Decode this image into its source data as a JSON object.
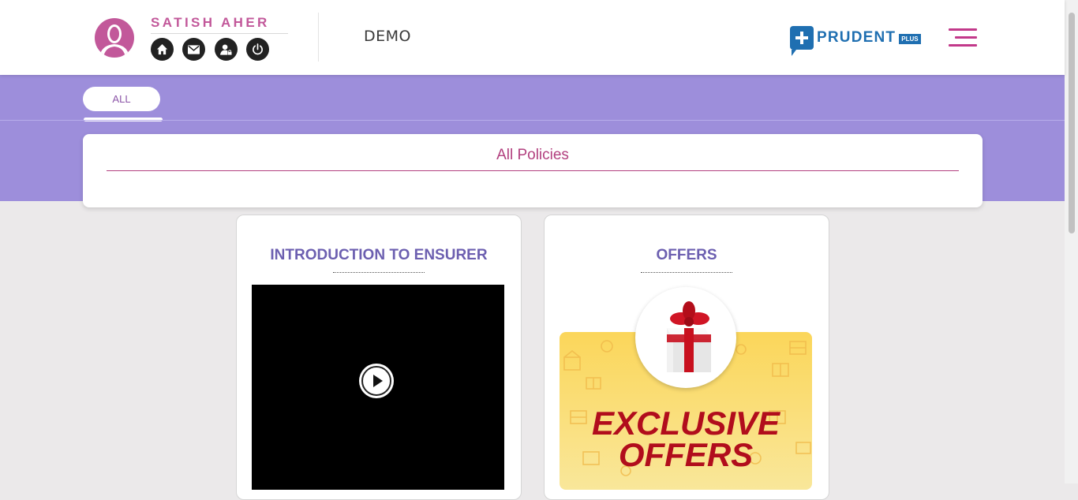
{
  "header": {
    "user_name": "SATISH AHER",
    "brand_logo": "DEMO",
    "partner_logo": {
      "name": "PRUDENT",
      "badge": "PLUS"
    },
    "icons": [
      "home-icon",
      "mail-icon",
      "profile-lock-icon",
      "power-icon"
    ]
  },
  "tabs": [
    {
      "label": "ALL",
      "active": true
    }
  ],
  "section": {
    "title": "All Policies"
  },
  "cards": [
    {
      "title": "INTRODUCTION TO ENSURER",
      "media": "video"
    },
    {
      "title": "OFFERS",
      "banner_line1": "EXCLUSIVE",
      "banner_line2": "OFFERS"
    }
  ],
  "colors": {
    "accent": "#c2589a",
    "band": "#9d8edb",
    "card_title": "#6c5fb0",
    "brand_blue": "#1f6fb1",
    "offer_red": "#b10d1c"
  }
}
